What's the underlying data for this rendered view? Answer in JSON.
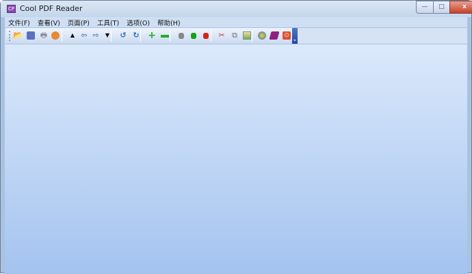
{
  "window": {
    "title": "Cool PDF Reader",
    "app_icon_text": "CP",
    "controls": {
      "minimize": "—",
      "maximize": "□",
      "close": "x"
    }
  },
  "menu": [
    {
      "label": "文件(F)"
    },
    {
      "label": "查看(V)"
    },
    {
      "label": "页面(P)"
    },
    {
      "label": "工具(T)"
    },
    {
      "label": "选项(O)"
    },
    {
      "label": "帮助(H)"
    }
  ],
  "toolbar": {
    "overflow": "»"
  },
  "colors": {
    "accent": "#1e47a0",
    "background_top": "#dbe9fb",
    "background_bottom": "#a4c3ef"
  }
}
